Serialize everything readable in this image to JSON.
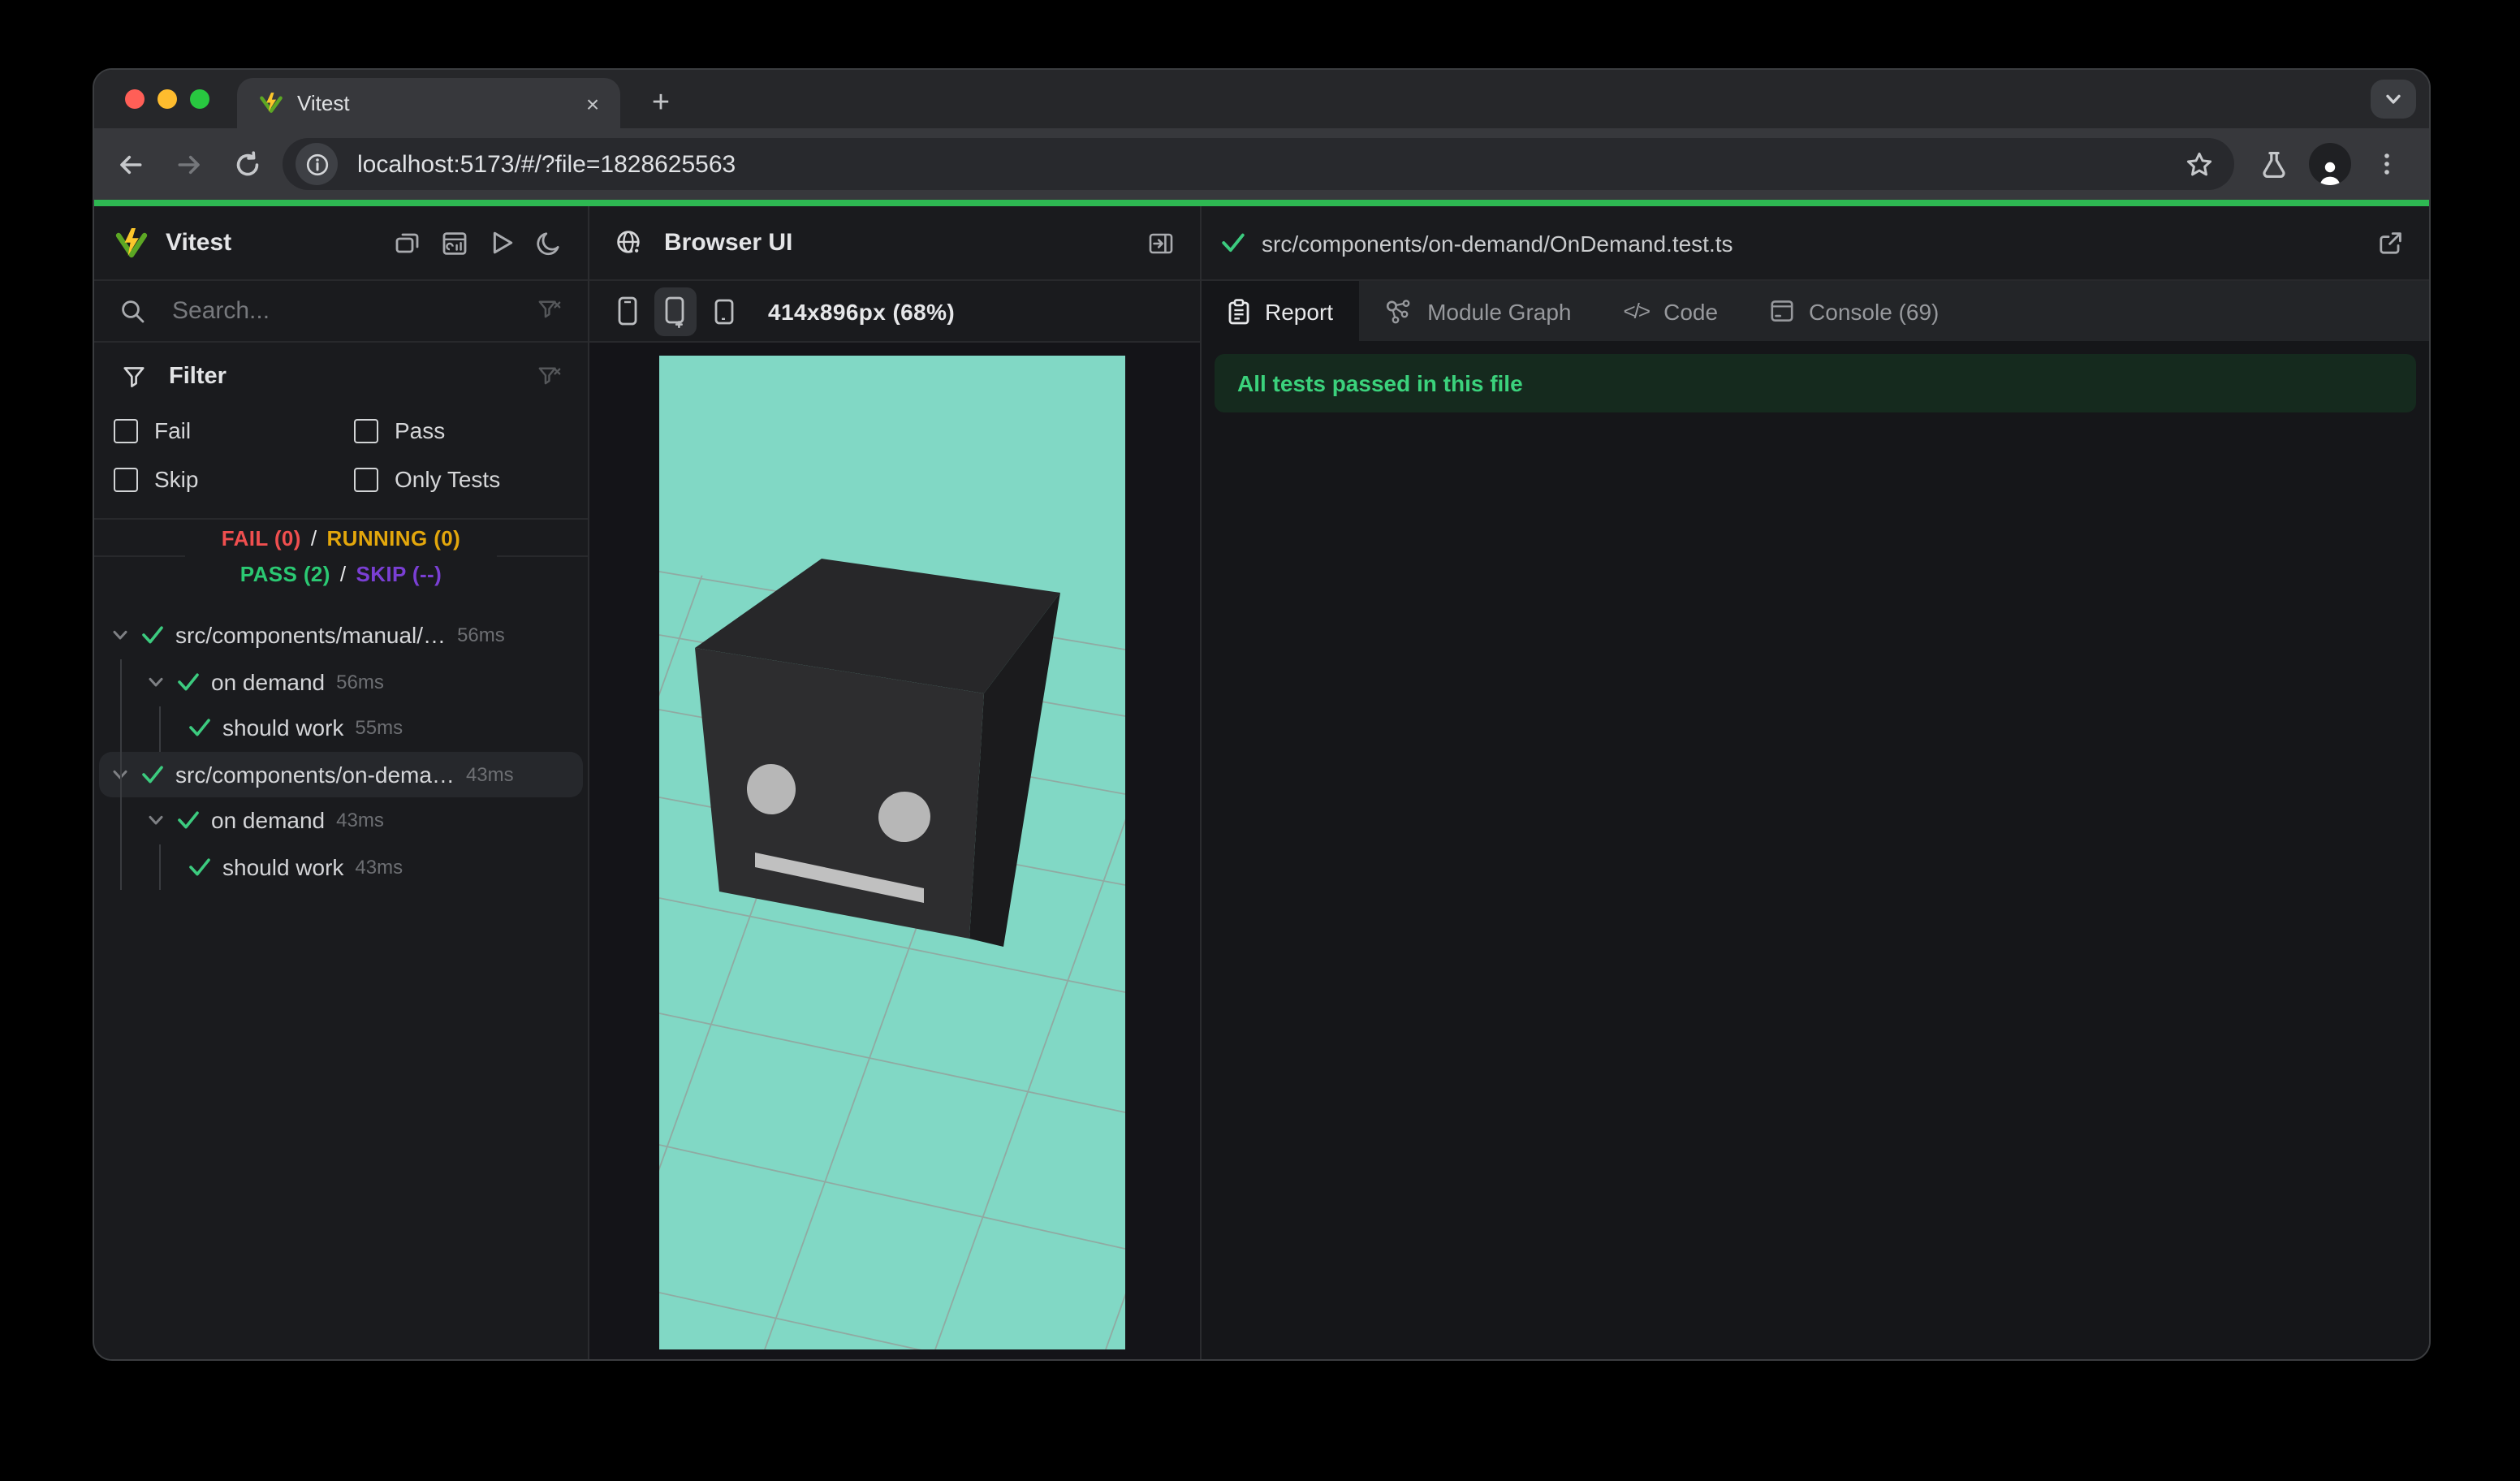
{
  "chrome": {
    "tab_title": "Vitest",
    "url": "localhost:5173/#/?file=1828625563",
    "close_glyph": "×",
    "new_tab_glyph": "+"
  },
  "sidebar": {
    "app_name": "Vitest",
    "search_placeholder": "Search...",
    "filter_title": "Filter",
    "filter_options": [
      "Fail",
      "Pass",
      "Skip",
      "Only Tests"
    ],
    "status": {
      "fail": "FAIL (0)",
      "running": "RUNNING (0)",
      "pass": "PASS (2)",
      "skip": "SKIP (--)",
      "separator": "/"
    },
    "tree": [
      {
        "label": "src/components/manual/…",
        "time": "56ms"
      },
      {
        "label": "on demand",
        "time": "56ms"
      },
      {
        "label": "should work",
        "time": "55ms"
      },
      {
        "label": "src/components/on-dema…",
        "time": "43ms"
      },
      {
        "label": "on demand",
        "time": "43ms"
      },
      {
        "label": "should work",
        "time": "43ms"
      }
    ]
  },
  "browser_panel": {
    "title": "Browser UI",
    "viewport_label": "414x896px (68%)"
  },
  "report_panel": {
    "file_path": "src/components/on-demand/OnDemand.test.ts",
    "tabs": [
      "Report",
      "Module Graph",
      "Code",
      "Console (69)"
    ],
    "code_glyph": "</>",
    "banner": "All tests passed in this file"
  },
  "colors": {
    "accent_green": "#3ccb7f",
    "fail_red": "#f04f4f",
    "running_amber": "#e3a70c",
    "pass_green": "#2bc973",
    "skip_purple": "#7a3fd4",
    "viewport_teal": "#81d8c5",
    "progress_green": "#2eb852",
    "banner_bg": "#152a1e"
  }
}
